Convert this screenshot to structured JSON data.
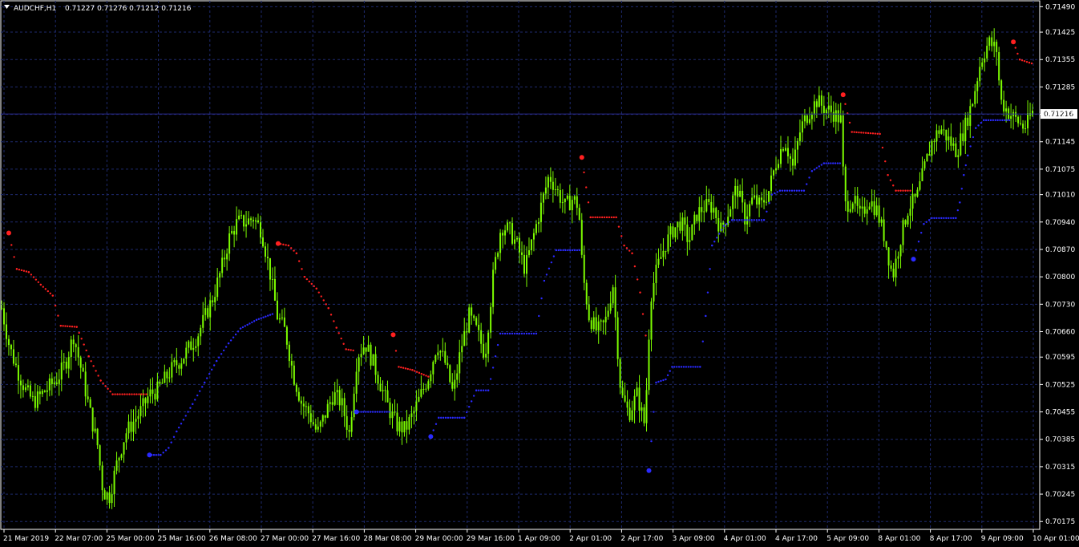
{
  "header": {
    "symbol_period": "AUDCHF,H1",
    "ohlc": "0.71227 0.71276 0.71212 0.71216"
  },
  "colors": {
    "background": "#000000",
    "grid": "#1e2a6e",
    "candles": "#7CFC00",
    "sar_above": "#ff2020",
    "sar_below": "#2a2aff",
    "current_price_line": "#2a2a8a"
  },
  "chart_data": {
    "type": "line",
    "title": "AUDCHF,H1",
    "y_ticks": [
      "0.71490",
      "0.71425",
      "0.71355",
      "0.71285",
      "0.71215",
      "0.71145",
      "0.71075",
      "0.71010",
      "0.70940",
      "0.70870",
      "0.70800",
      "0.70730",
      "0.70660",
      "0.70595",
      "0.70525",
      "0.70455",
      "0.70385",
      "0.70315",
      "0.70245",
      "0.70175"
    ],
    "x_ticks": [
      "21 Mar 2019",
      "22 Mar 07:00",
      "25 Mar 00:00",
      "25 Mar 16:00",
      "26 Mar 08:00",
      "27 Mar 00:00",
      "27 Mar 16:00",
      "28 Mar 08:00",
      "29 Mar 00:00",
      "29 Mar 16:00",
      "1 Apr 09:00",
      "2 Apr 01:00",
      "2 Apr 17:00",
      "3 Apr 09:00",
      "4 Apr 01:00",
      "4 Apr 17:00",
      "5 Apr 09:00",
      "8 Apr 01:00",
      "8 Apr 17:00",
      "9 Apr 09:00",
      "10 Apr 01:00"
    ],
    "ylim": [
      0.70155,
      0.71505
    ],
    "current_price": "0.71216",
    "grid": true,
    "series": [
      {
        "values": [
          [
            0,
            0.7072
          ],
          [
            10,
            0.7062
          ],
          [
            20,
            0.7056
          ],
          [
            30,
            0.7051
          ],
          [
            40,
            0.7048
          ],
          [
            50,
            0.705
          ],
          [
            60,
            0.7052
          ],
          [
            70,
            0.7054
          ],
          [
            80,
            0.7058
          ],
          [
            90,
            0.7065
          ],
          [
            100,
            0.7056
          ],
          [
            110,
            0.7046
          ],
          [
            120,
            0.7037
          ],
          [
            127,
            0.7025
          ],
          [
            135,
            0.7024
          ],
          [
            145,
            0.7033
          ],
          [
            155,
            0.704
          ],
          [
            165,
            0.7043
          ],
          [
            175,
            0.7046
          ],
          [
            185,
            0.705
          ],
          [
            195,
            0.7051
          ],
          [
            205,
            0.7054
          ],
          [
            215,
            0.7057
          ],
          [
            225,
            0.7059
          ],
          [
            235,
            0.7062
          ],
          [
            245,
            0.7065
          ],
          [
            255,
            0.707
          ],
          [
            265,
            0.7075
          ],
          [
            275,
            0.7082
          ],
          [
            285,
            0.709
          ],
          [
            295,
            0.7094
          ],
          [
            305,
            0.7094
          ],
          [
            315,
            0.7095
          ],
          [
            325,
            0.7092
          ],
          [
            335,
            0.7082
          ],
          [
            345,
            0.707
          ],
          [
            355,
            0.7066
          ],
          [
            365,
            0.7055
          ],
          [
            375,
            0.7048
          ],
          [
            385,
            0.7045
          ],
          [
            395,
            0.704
          ],
          [
            405,
            0.7045
          ],
          [
            415,
            0.705
          ],
          [
            425,
            0.7048
          ],
          [
            435,
            0.704
          ],
          [
            445,
            0.706
          ],
          [
            455,
            0.7063
          ],
          [
            465,
            0.7058
          ],
          [
            475,
            0.7052
          ],
          [
            485,
            0.7046
          ],
          [
            495,
            0.7042
          ],
          [
            505,
            0.7041
          ],
          [
            515,
            0.7045
          ],
          [
            525,
            0.705
          ],
          [
            535,
            0.7055
          ],
          [
            545,
            0.7063
          ],
          [
            555,
            0.7058
          ],
          [
            565,
            0.705
          ],
          [
            575,
            0.7062
          ],
          [
            585,
            0.707
          ],
          [
            595,
            0.7066
          ],
          [
            605,
            0.706
          ],
          [
            615,
            0.708
          ],
          [
            625,
            0.7093
          ],
          [
            635,
            0.7092
          ],
          [
            645,
            0.7088
          ],
          [
            655,
            0.7082
          ],
          [
            665,
            0.709
          ],
          [
            675,
            0.7098
          ],
          [
            685,
            0.7106
          ],
          [
            695,
            0.7102
          ],
          [
            705,
            0.7098
          ],
          [
            715,
            0.71
          ],
          [
            722,
            0.7098
          ],
          [
            727,
            0.7081
          ],
          [
            735,
            0.707
          ],
          [
            745,
            0.7066
          ],
          [
            755,
            0.7068
          ],
          [
            765,
            0.7078
          ],
          [
            775,
            0.705
          ],
          [
            785,
            0.7045
          ],
          [
            795,
            0.705
          ],
          [
            805,
            0.7042
          ],
          [
            812,
            0.7075
          ],
          [
            820,
            0.7082
          ],
          [
            830,
            0.7088
          ],
          [
            840,
            0.7092
          ],
          [
            850,
            0.7094
          ],
          [
            860,
            0.7089
          ],
          [
            870,
            0.7096
          ],
          [
            880,
            0.7098
          ],
          [
            890,
            0.7098
          ],
          [
            900,
            0.7092
          ],
          [
            910,
            0.7097
          ],
          [
            920,
            0.7103
          ],
          [
            930,
            0.7095
          ],
          [
            940,
            0.71
          ],
          [
            950,
            0.7098
          ],
          [
            960,
            0.7102
          ],
          [
            970,
            0.711
          ],
          [
            980,
            0.7115
          ],
          [
            990,
            0.7108
          ],
          [
            1000,
            0.7118
          ],
          [
            1010,
            0.7122
          ],
          [
            1020,
            0.7125
          ],
          [
            1030,
            0.7123
          ],
          [
            1040,
            0.7122
          ],
          [
            1050,
            0.712
          ],
          [
            1055,
            0.7098
          ],
          [
            1065,
            0.71
          ],
          [
            1075,
            0.7095
          ],
          [
            1085,
            0.71
          ],
          [
            1095,
            0.7097
          ],
          [
            1105,
            0.709
          ],
          [
            1115,
            0.708
          ],
          [
            1125,
            0.709
          ],
          [
            1135,
            0.7098
          ],
          [
            1145,
            0.71
          ],
          [
            1155,
            0.7108
          ],
          [
            1165,
            0.7115
          ],
          [
            1175,
            0.7118
          ],
          [
            1185,
            0.7115
          ],
          [
            1195,
            0.7112
          ],
          [
            1205,
            0.7118
          ],
          [
            1215,
            0.7125
          ],
          [
            1225,
            0.7135
          ],
          [
            1235,
            0.714
          ],
          [
            1245,
            0.7138
          ],
          [
            1250,
            0.7125
          ],
          [
            1260,
            0.7122
          ],
          [
            1270,
            0.712
          ],
          [
            1280,
            0.7118
          ],
          [
            1290,
            0.7122
          ]
        ]
      },
      {
        "values": [
          [
            10,
            0.70912
          ],
          [
            20,
            0.7082
          ],
          [
            35,
            0.70812
          ],
          [
            50,
            0.7078
          ],
          [
            65,
            0.70752
          ],
          [
            75,
            0.70675
          ],
          [
            95,
            0.70672
          ],
          [
            110,
            0.70597
          ],
          [
            125,
            0.70535
          ],
          [
            140,
            0.705
          ],
          [
            182,
            0.705
          ]
        ]
      },
      {
        "values": [
          [
            186,
            0.70345
          ],
          [
            200,
            0.70345
          ],
          [
            210,
            0.70363
          ],
          [
            220,
            0.70405
          ],
          [
            240,
            0.70475
          ],
          [
            255,
            0.7053
          ],
          [
            270,
            0.70585
          ],
          [
            285,
            0.7063
          ],
          [
            300,
            0.70668
          ],
          [
            320,
            0.7069
          ],
          [
            340,
            0.70705
          ]
        ]
      },
      {
        "values": [
          [
            347,
            0.70885
          ],
          [
            360,
            0.7088
          ],
          [
            370,
            0.7086
          ],
          [
            380,
            0.708
          ],
          [
            395,
            0.7077
          ],
          [
            410,
            0.7072
          ],
          [
            420,
            0.7067
          ],
          [
            432,
            0.70615
          ],
          [
            441,
            0.70612
          ]
        ]
      },
      {
        "values": [
          [
            445,
            0.70455
          ],
          [
            486,
            0.70455
          ]
        ]
      },
      {
        "values": [
          [
            491,
            0.70652
          ],
          [
            498,
            0.7057
          ],
          [
            515,
            0.70562
          ],
          [
            535,
            0.70545
          ]
        ]
      },
      {
        "values": [
          [
            538,
            0.70392
          ],
          [
            548,
            0.7044
          ],
          [
            580,
            0.7044
          ],
          [
            595,
            0.7051
          ],
          [
            610,
            0.7051
          ],
          [
            625,
            0.70655
          ],
          [
            670,
            0.70655
          ],
          [
            680,
            0.7079
          ],
          [
            695,
            0.70868
          ],
          [
            724,
            0.70868
          ]
        ]
      },
      {
        "values": [
          [
            727,
            0.71105
          ],
          [
            738,
            0.70952
          ],
          [
            770,
            0.70952
          ],
          [
            780,
            0.7088
          ],
          [
            790,
            0.7086
          ],
          [
            800,
            0.7076
          ],
          [
            807,
            0.7065
          ]
        ]
      },
      {
        "values": [
          [
            811,
            0.70305
          ],
          [
            820,
            0.7053
          ],
          [
            832,
            0.70538
          ],
          [
            840,
            0.7057
          ],
          [
            875,
            0.7057
          ],
          [
            882,
            0.707
          ],
          [
            890,
            0.7088
          ],
          [
            905,
            0.7093
          ],
          [
            915,
            0.70945
          ],
          [
            955,
            0.70945
          ],
          [
            965,
            0.7101
          ],
          [
            975,
            0.7102
          ],
          [
            1005,
            0.7102
          ],
          [
            1015,
            0.7107
          ],
          [
            1030,
            0.7109
          ],
          [
            1050,
            0.7109
          ]
        ]
      },
      {
        "values": [
          [
            1054,
            0.71265
          ],
          [
            1065,
            0.7117
          ],
          [
            1100,
            0.71165
          ],
          [
            1110,
            0.7106
          ],
          [
            1120,
            0.7102
          ],
          [
            1138,
            0.7102
          ]
        ]
      },
      {
        "values": [
          [
            1142,
            0.70845
          ],
          [
            1155,
            0.70935
          ],
          [
            1165,
            0.7095
          ],
          [
            1195,
            0.7095
          ],
          [
            1200,
            0.7099
          ],
          [
            1205,
            0.7106
          ],
          [
            1210,
            0.7111
          ],
          [
            1220,
            0.7118
          ],
          [
            1230,
            0.712
          ],
          [
            1262,
            0.712
          ]
        ]
      },
      {
        "values": [
          [
            1267,
            0.714
          ],
          [
            1275,
            0.71355
          ],
          [
            1290,
            0.71345
          ]
        ]
      }
    ]
  }
}
